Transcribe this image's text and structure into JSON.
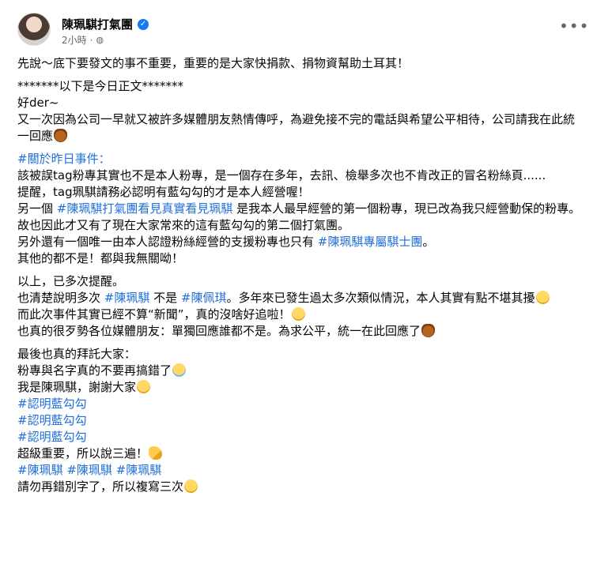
{
  "header": {
    "page_name": "陳珮騏打氣團",
    "verified_icon": "verified-check-icon",
    "timestamp": "2小時",
    "separator": "·",
    "audience_icon": "globe-icon",
    "more_icon": "more-options-icon",
    "more_label": "•••"
  },
  "post": {
    "p1": "先說～底下要發文的事不重要，重要的是大家快捐款、捐物資幫助土耳其！",
    "p2": "*******以下是今日正文*******",
    "p3_l1": "好der~",
    "p3_l2": "又一次因為公司一早就又被許多媒體朋友熱情傳呼，為避免接不完的電話與希望公平相待，公司請我在此統一回應",
    "p4_tag": "#關於昨日事件：",
    "p4_l2": "該被誤tag粉專其實也不是本人粉專，是一個存在多年，去訊、檢舉多次也不肯改正的冒名粉絲頁......",
    "p4_l3": "提醒，tag珮騏請務必認明有藍勾勾的才是本人經營喔！",
    "p4_l4a": "另一個 ",
    "p4_l4tag": "#陳珮騏打氣團看見真實看見珮騏",
    "p4_l4b": " 是我本人最早經營的第一個粉專，現已改為我只經營動保的粉專。故也因此才又有了現在大家常來的這有藍勾勾的第二個打氣團。",
    "p4_l5a": "另外還有一個唯一由本人認證粉絲經營的支援粉專也只有 ",
    "p4_l5tag": "#陳珮騏專屬騏士團",
    "p4_l5b": "。",
    "p4_l6": "其他的都不是！都與我無關呦！",
    "p5_l1": "以上，已多次提醒。",
    "p5_l2a": "也清楚說明多次 ",
    "p5_l2tag1": "#陳珮騏",
    "p5_l2b": " 不是 ",
    "p5_l2tag2": "#陳佩琪",
    "p5_l2c": "。多年來已發生過太多次類似情況，本人其實有點不堪其擾",
    "p5_l3": "而此次事件其實已經不算“新聞”，真的沒啥好追啦！",
    "p5_l4": "也真的很歹勢各位媒體朋友：單獨回應誰都不是。為求公平，統一在此回應了",
    "p6_l1": "最後也真的拜託大家：",
    "p6_l2": "粉專與名字真的不要再搞錯了",
    "p6_l3": "我是陳珮騏，謝謝大家",
    "p6_tag1": "#認明藍勾勾",
    "p6_tag2": "#認明藍勾勾",
    "p6_tag3": "#認明藍勾勾",
    "p6_l7": "超級重要，所以說三遍！",
    "p6_tags": "#陳珮騏 #陳珮騏 #陳珮騏",
    "p6_l9": "請勿再錯別字了，所以複寫三次"
  },
  "colors": {
    "hashtag": "#216fdb",
    "verified": "#1877f2",
    "meta": "#65676b"
  }
}
